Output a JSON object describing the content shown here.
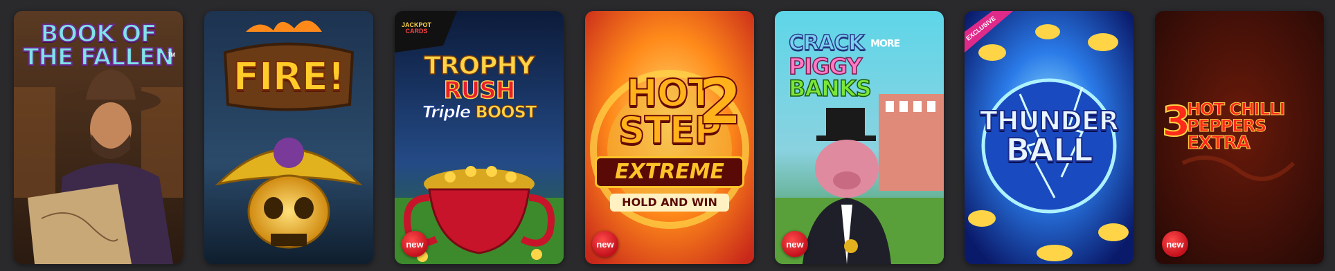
{
  "games": [
    {
      "title_line1": "BOOK OF",
      "title_line2": "THE FALLEN",
      "trademark": "TM"
    },
    {
      "title": "FIRE!"
    },
    {
      "corner_logo_line1": "JACKPOT",
      "corner_logo_line2": "CARDS",
      "title_line1": "TROPHY",
      "title_line2": "RUSH",
      "sub1": "Triple",
      "sub2": "BOOST",
      "badge": "new"
    },
    {
      "title_line1": "HOT",
      "title_line2": "STEP",
      "digit": "2",
      "banner": "EXTREME",
      "tagline": "HOLD AND WIN",
      "badge": "new"
    },
    {
      "title_line1": "CRACK",
      "title_word2": "MORE",
      "title_line2a": "PIGGY",
      "title_line2b": "BANKS",
      "badge": "new"
    },
    {
      "ribbon": "EXCLUSIVE",
      "title_line1": "THUNDER",
      "title_line2": "BALL"
    },
    {
      "title_num": "3",
      "title_line1": "HOT CHILLI",
      "title_line2": "PEPPERS",
      "title_line3": "EXTRA",
      "badge": "new"
    }
  ]
}
